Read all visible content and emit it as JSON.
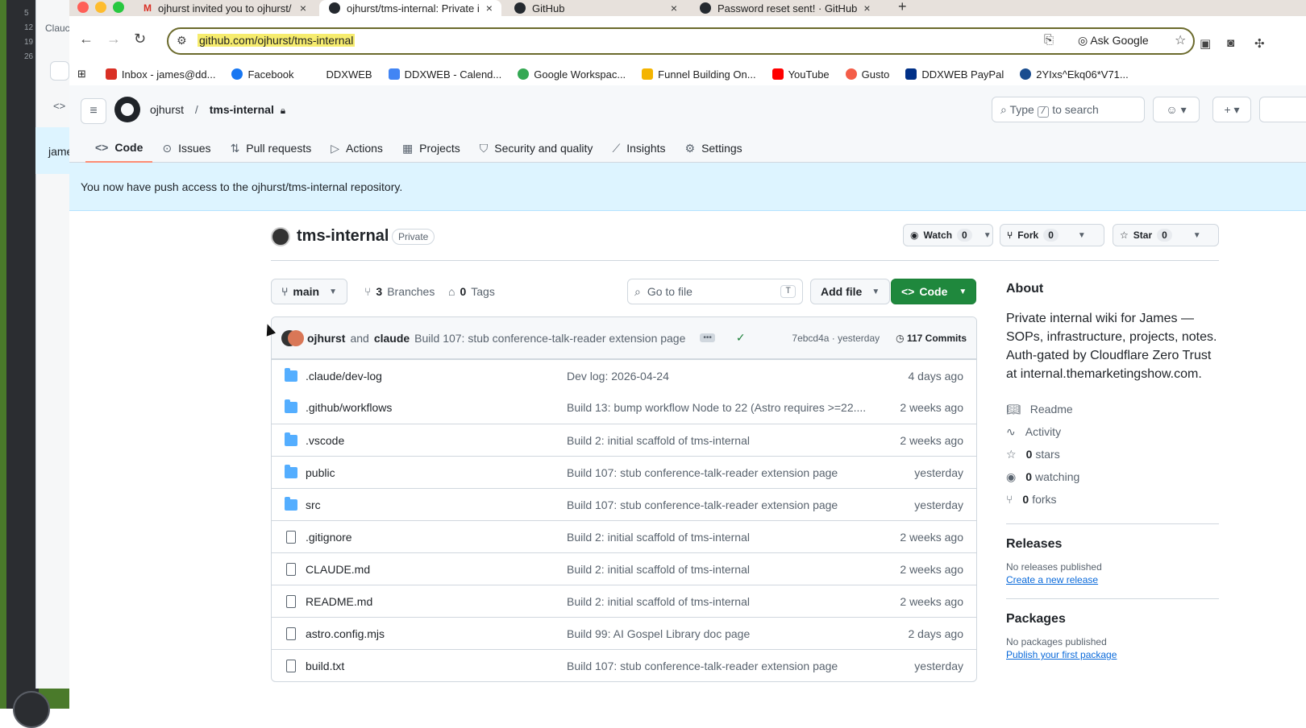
{
  "background_window": {
    "line_numbers": [
      "5",
      "12",
      "19",
      "26"
    ],
    "label": "Clauc",
    "row_label": "jame"
  },
  "browser": {
    "tabs": [
      {
        "title": "ojhurst invited you to ojhurst/",
        "icon": "gmail-icon"
      },
      {
        "title": "ojhurst/tms-internal: Private i",
        "icon": "github-icon"
      },
      {
        "title": "GitHub",
        "icon": "github-icon"
      },
      {
        "title": "Password reset sent! · GitHub",
        "icon": "github-icon"
      }
    ],
    "url": "github.com/ojhurst/tms-internal",
    "ask_google": "Ask Google",
    "bookmarks": [
      {
        "label": "Inbox - james@dd...",
        "color": "#d93025"
      },
      {
        "label": "Facebook",
        "color": "#1877f2"
      },
      {
        "label": "DDXWEB",
        "color": "#ffffff"
      },
      {
        "label": "DDXWEB - Calend...",
        "color": "#4285f4"
      },
      {
        "label": "Google Workspac...",
        "color": "#34a853"
      },
      {
        "label": "Funnel Building On...",
        "color": "#f4b400"
      },
      {
        "label": "YouTube",
        "color": "#ff0000"
      },
      {
        "label": "Gusto",
        "color": "#f45d48"
      },
      {
        "label": "DDXWEB PayPal",
        "color": "#003087"
      },
      {
        "label": "2YIxs^Ekq06*V71...",
        "color": "#1a4d8f"
      }
    ]
  },
  "github": {
    "owner": "ojhurst",
    "repo": "tms-internal",
    "search_prefix": "Type",
    "search_key": "/",
    "search_suffix": "to search",
    "repo_tabs": [
      "Code",
      "Issues",
      "Pull requests",
      "Actions",
      "Projects",
      "Security and quality",
      "Insights",
      "Settings"
    ],
    "flash": "You now have push access to the ojhurst/tms-internal repository.",
    "visibility": "Private",
    "watch": {
      "label": "Watch",
      "count": "0"
    },
    "fork": {
      "label": "Fork",
      "count": "0"
    },
    "star": {
      "label": "Star",
      "count": "0"
    },
    "branch": "main",
    "branches_count": "3",
    "branches_label": "Branches",
    "tags_count": "0",
    "tags_label": "Tags",
    "goto_placeholder": "Go to file",
    "goto_key": "T",
    "add_file": "Add file",
    "code_btn": "Code",
    "commit": {
      "author1": "ojhurst",
      "and": "and",
      "author2": "claude",
      "message": "Build 107: stub conference-talk-reader extension page",
      "hash": "7ebcd4a · yesterday",
      "count": "117 Commits"
    },
    "files": [
      {
        "name": ".claude/dev-log",
        "type": "dir",
        "message": "Dev log: 2026-04-24",
        "date": "4 days ago"
      },
      {
        "name": ".github/workflows",
        "type": "dir",
        "message": "Build 13: bump workflow Node to 22 (Astro requires >=22....",
        "date": "2 weeks ago"
      },
      {
        "name": ".vscode",
        "type": "dir",
        "message": "Build 2: initial scaffold of tms-internal",
        "date": "2 weeks ago"
      },
      {
        "name": "public",
        "type": "dir",
        "message": "Build 107: stub conference-talk-reader extension page",
        "date": "yesterday"
      },
      {
        "name": "src",
        "type": "dir",
        "message": "Build 107: stub conference-talk-reader extension page",
        "date": "yesterday"
      },
      {
        "name": ".gitignore",
        "type": "file",
        "message": "Build 2: initial scaffold of tms-internal",
        "date": "2 weeks ago"
      },
      {
        "name": "CLAUDE.md",
        "type": "file",
        "message": "Build 2: initial scaffold of tms-internal",
        "date": "2 weeks ago"
      },
      {
        "name": "README.md",
        "type": "file",
        "message": "Build 2: initial scaffold of tms-internal",
        "date": "2 weeks ago"
      },
      {
        "name": "astro.config.mjs",
        "type": "file",
        "message": "Build 99: AI Gospel Library doc page",
        "date": "2 days ago"
      },
      {
        "name": "build.txt",
        "type": "file",
        "message": "Build 107: stub conference-talk-reader extension page",
        "date": "yesterday"
      }
    ],
    "about": {
      "title": "About",
      "description": "Private internal wiki for James — SOPs, infrastructure, projects, notes. Auth-gated by Cloudflare Zero Trust at internal.themarketingshow.com.",
      "readme": "Readme",
      "activity": "Activity",
      "stars_count": "0",
      "stars_label": "stars",
      "watching_count": "0",
      "watching_label": "watching",
      "forks_count": "0",
      "forks_label": "forks"
    },
    "releases": {
      "title": "Releases",
      "empty": "No releases published",
      "link": "Create a new release"
    },
    "packages": {
      "title": "Packages",
      "empty": "No packages published",
      "link": "Publish your first package"
    }
  }
}
